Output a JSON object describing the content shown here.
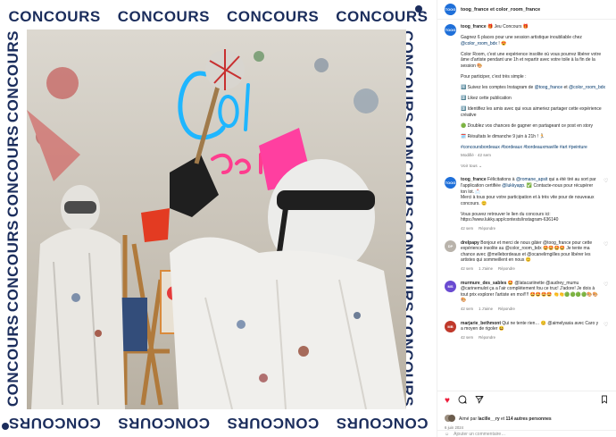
{
  "media": {
    "banner_word": "CONCOURS",
    "colors": {
      "banner": "#1b2d5c",
      "neon_blue": "#1fb6ff",
      "neon_pink": "#ff3c8e"
    },
    "neon_text": "Color Room"
  },
  "header": {
    "avatar_text": "TOOG",
    "title": "toog_france et color_room_france"
  },
  "caption": {
    "username": "toog_france",
    "headline": "🎁 Jeu Concours 🎁",
    "p1_a": "Gagnez 6 places pour une session artistique inoubliable chez ",
    "p1_mention": "@color_room_bdx",
    "p1_b": " ! 😍",
    "p2": "Color Room, c'est une expérience insolite où vous pourrez libérer votre âme d'artiste pendant une 1h et repartir avec votre toile à la fin de la session 🎨",
    "p3": "Pour participer, c'est très simple :",
    "s1_a": "1️⃣ Suivez les comptes Instagram de ",
    "s1_m1": "@toog_france",
    "s1_b": " et ",
    "s1_m2": "@color_room_bdx",
    "s2": "2️⃣ Likez cette publication",
    "s3": "3️⃣ Identifiez les amis avec qui vous aimeriez partager cette expérience créative",
    "s4": "🟢 Doublez vos chances de gagner en partageant ce post en story",
    "s5": "🗓️ Résultats le dimanche 9 juin à 21h ! 🏃",
    "hashtags": "#concoursbordeaux #bordeaux #bordeauxmaville #art #peinture",
    "meta": "Modifié · 42 sem"
  },
  "voir_tous": "Voir tous ⌄",
  "comments": [
    {
      "user": "toog_france",
      "avatar": "TOOG",
      "text_a": "Félicitations à ",
      "mention": "@romane_apsit",
      "text_b": " qui a été tiré au sort par l'application certifiée ",
      "mention2": "@lukkyapp",
      "text_c": ". ✅ Contacte-nous pour récupérer ton lot. 📩",
      "text_d": "Merci à tous pour votre participation et à très vite pour de nouveaux concours. 😊",
      "text_e": "Vous pouvez retrouver le lien du concours ici: https://www.lukky.app/contests/instagram-636140",
      "time": "42 sem",
      "reply": "Répondre"
    },
    {
      "user": "drelpapy",
      "avatar": "DP",
      "text": "Bonjour et merci de nous gâter @toog_france pour cette expérience insolite au @color_room_bdx 🤩🤩🤩🤩 Je tente ma chance avec @mellebordeaux et @ocanelirngilles pour libérer les artistes qui sommeillent en nous 😊",
      "time": "42 sem",
      "likes": "1 J'aime",
      "reply": "Répondre"
    },
    {
      "user": "murmure_des_sables",
      "avatar": "MS",
      "text": "🤩 @latacariinette @audrey_mumu @carinemulot ça a l'air complètement fou ce truc! J'adore! Je dois à tout prix explorer l'artiste en moi!!!! 🤩🤩🤩🤩 👏👏🟢🟢🟢🟢🎨🎨🎨",
      "time": "42 sem",
      "likes": "1 J'aime",
      "reply": "Répondre"
    },
    {
      "user": "marjarie_bethmont",
      "avatar": "MB",
      "text": "Qui ne tente rien… 😊 @aimelyasia avec Caro y a moyen de rigoler 😆",
      "time": "42 sem",
      "reply": "Répondre"
    }
  ],
  "actions": {
    "likes_text_a": "Aimé par ",
    "likes_user": "lacille__ry",
    "likes_text_b": " et ",
    "likes_count": "114 autres personnes",
    "date": "6 juin 2024",
    "add_comment_placeholder": "Ajouter un commentaire…"
  }
}
